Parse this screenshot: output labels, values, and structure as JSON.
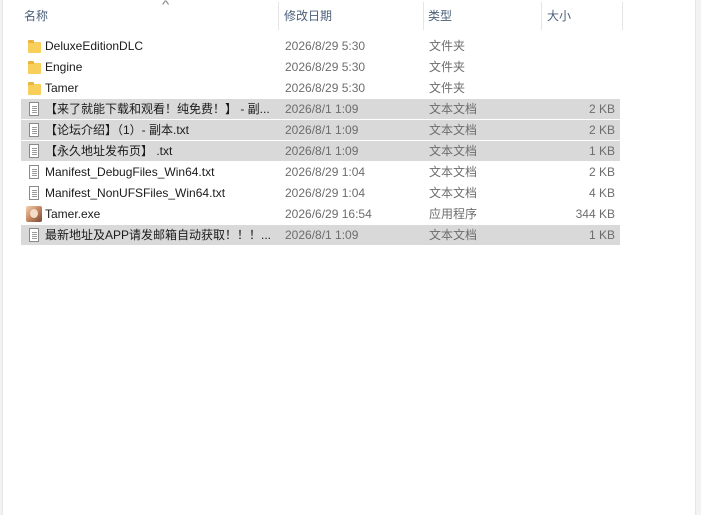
{
  "header": {
    "name_label": "名称",
    "date_label": "修改日期",
    "type_label": "类型",
    "size_label": "大小",
    "sort_arrow": "^"
  },
  "files": [
    {
      "name": "DeluxeEditionDLC",
      "date": "2026/8/29 5:30",
      "type": "文件夹",
      "size": "",
      "icon": "folder-icon",
      "selected": false
    },
    {
      "name": "Engine",
      "date": "2026/8/29 5:30",
      "type": "文件夹",
      "size": "",
      "icon": "folder-icon",
      "selected": false
    },
    {
      "name": "Tamer",
      "date": "2026/8/29 5:30",
      "type": "文件夹",
      "size": "",
      "icon": "folder-icon",
      "selected": false
    },
    {
      "name": "【来了就能下载和观看！纯免费！】 - 副...",
      "date": "2026/8/1 1:09",
      "type": "文本文档",
      "size": "2 KB",
      "icon": "text-file-icon",
      "selected": true
    },
    {
      "name": "【论坛介绍】（1）- 副本.txt",
      "date": "2026/8/1 1:09",
      "type": "文本文档",
      "size": "2 KB",
      "icon": "text-file-icon",
      "selected": true
    },
    {
      "name": "【永久地址发布页】 .txt",
      "date": "2026/8/1 1:09",
      "type": "文本文档",
      "size": "1 KB",
      "icon": "text-file-icon",
      "selected": true
    },
    {
      "name": "Manifest_DebugFiles_Win64.txt",
      "date": "2026/8/29 1:04",
      "type": "文本文档",
      "size": "2 KB",
      "icon": "text-file-icon",
      "selected": false
    },
    {
      "name": "Manifest_NonUFSFiles_Win64.txt",
      "date": "2026/8/29 1:04",
      "type": "文本文档",
      "size": "4 KB",
      "icon": "text-file-icon",
      "selected": false
    },
    {
      "name": "Tamer.exe",
      "date": "2026/6/29 16:54",
      "type": "应用程序",
      "size": "344 KB",
      "icon": "application-icon",
      "selected": false
    },
    {
      "name": "最新地址及APP请发邮箱自动获取！！！...",
      "date": "2026/8/1 1:09",
      "type": "文本文档",
      "size": "1 KB",
      "icon": "text-file-icon",
      "selected": true
    }
  ],
  "colors": {
    "selection": "#d9d9d9",
    "header_text": "#4c607a",
    "folder": "#f8cf5a"
  }
}
